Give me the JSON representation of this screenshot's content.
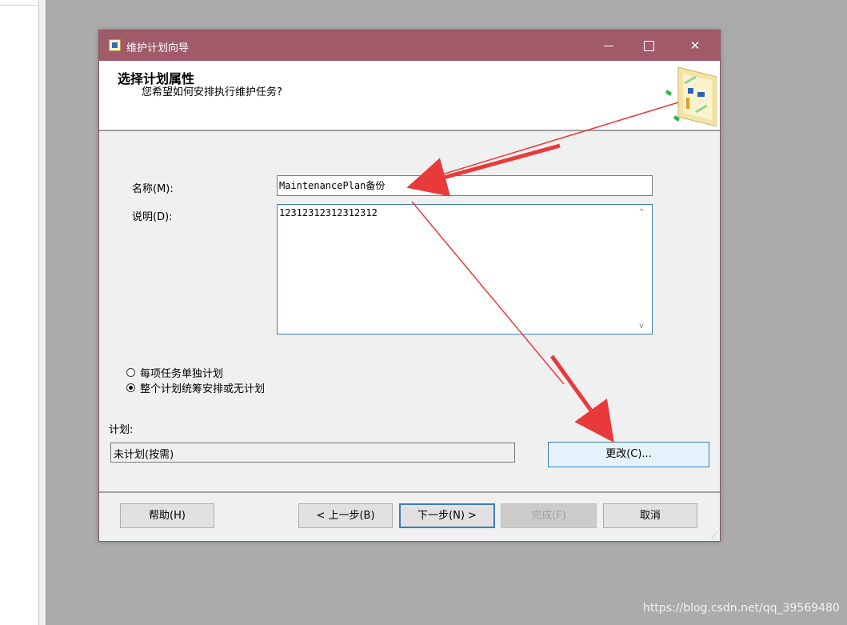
{
  "dialog": {
    "title": "维护计划向导",
    "header_title": "选择计划属性",
    "header_subtitle": "您希望如何安排执行维护任务?",
    "name_label": "名称(M):",
    "name_value": "MaintenancePlan备份",
    "description_label": "说明(D):",
    "description_value": "12312312312312312",
    "radio_options": [
      {
        "label": "每项任务单独计划",
        "checked": false
      },
      {
        "label": "整个计划统筹安排或无计划",
        "checked": true
      }
    ],
    "schedule_label": "计划:",
    "schedule_value": "未计划(按需)",
    "change_button": "更改(C)...",
    "buttons": {
      "help": "帮助(H)",
      "back": "< 上一步(B)",
      "next": "下一步(N) >",
      "finish": "完成(F)",
      "cancel": "取消"
    }
  },
  "window_controls": {
    "minimize_icon": "minimize-icon",
    "maximize_icon": "maximize-icon",
    "close_icon": "close-icon",
    "close_glyph": "✕"
  },
  "scrollbar": {
    "up": "^",
    "down": "v"
  },
  "colors": {
    "titlebar": "#a05a6a",
    "annotation_arrow": "#e83a3a",
    "focus_border": "#3c7fb1"
  },
  "watermark": "https://blog.csdn.net/qq_39569480"
}
